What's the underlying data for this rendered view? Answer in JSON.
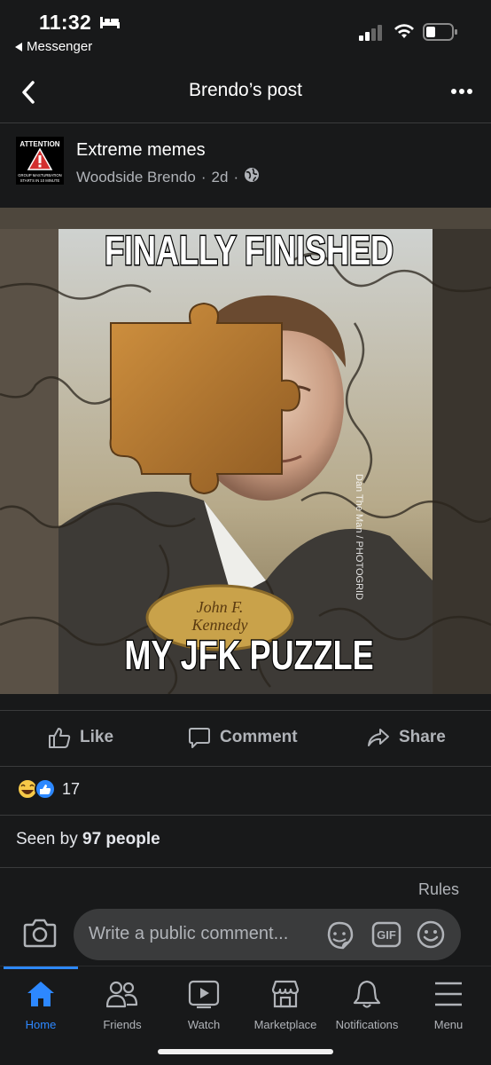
{
  "status_bar": {
    "time": "11:32",
    "back_app": "Messenger"
  },
  "nav": {
    "title": "Brendo’s post"
  },
  "post": {
    "group_name": "Extreme memes",
    "author": "Woodside Brendo",
    "time_ago": "2d",
    "avatar_text": {
      "line1": "ATTENTION",
      "line2": "GROUP MASTURBATION",
      "line3": "STARTS IN 10 MINUTE"
    },
    "image": {
      "top_caption": "FINALLY FINISHED",
      "bottom_caption": "MY JFK PUZZLE",
      "plaque_line1": "John F.",
      "plaque_line2": "Kennedy",
      "watermark": "Dan The Man / PHOTOGRID"
    }
  },
  "actions": {
    "like": "Like",
    "comment": "Comment",
    "share": "Share"
  },
  "reactions": {
    "count": "17",
    "types": [
      "haha",
      "like"
    ]
  },
  "seen": {
    "prefix": "Seen by",
    "count_text": "97 people"
  },
  "comment": {
    "rules": "Rules",
    "placeholder": "Write a public comment..."
  },
  "tabs": [
    {
      "label": "Home",
      "icon": "home-icon",
      "active": true
    },
    {
      "label": "Friends",
      "icon": "friends-icon",
      "active": false
    },
    {
      "label": "Watch",
      "icon": "watch-icon",
      "active": false
    },
    {
      "label": "Marketplace",
      "icon": "marketplace-icon",
      "active": false
    },
    {
      "label": "Notifications",
      "icon": "bell-icon",
      "active": false
    },
    {
      "label": "Menu",
      "icon": "menu-icon",
      "active": false
    }
  ],
  "colors": {
    "background": "#18191a",
    "accent": "#2d88ff",
    "secondary_text": "#b0b3b8",
    "input_bg": "#3a3b3c"
  }
}
